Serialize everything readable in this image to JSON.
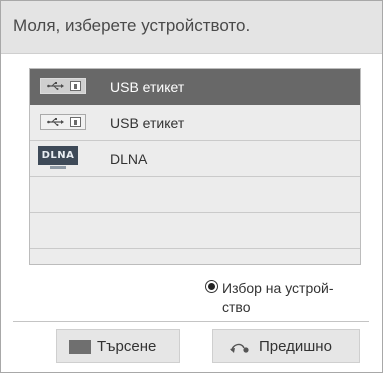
{
  "dialog": {
    "title": "Моля, изберете устройството."
  },
  "devices": [
    {
      "label": "USB етикет",
      "icon": "usb-icon",
      "selected": true
    },
    {
      "label": "USB етикет",
      "icon": "usb-icon",
      "selected": false
    },
    {
      "label": "DLNA",
      "icon": "dlna-icon",
      "icon_text": "DLNA",
      "selected": false
    },
    {
      "label": "",
      "selected": false
    },
    {
      "label": "",
      "selected": false
    }
  ],
  "device_select": {
    "label": "Избор на устрой-\nство",
    "checked": true
  },
  "buttons": {
    "search_label": "Търсене",
    "search_icon": "color-key-icon",
    "previous_label": "Предишно",
    "previous_icon": "back-arrow-icon"
  },
  "colors": {
    "header_bg": "#e4e4e4",
    "selected_row_bg": "#686868",
    "list_bg": "#ececec",
    "button_bg": "#e6e6e6"
  }
}
